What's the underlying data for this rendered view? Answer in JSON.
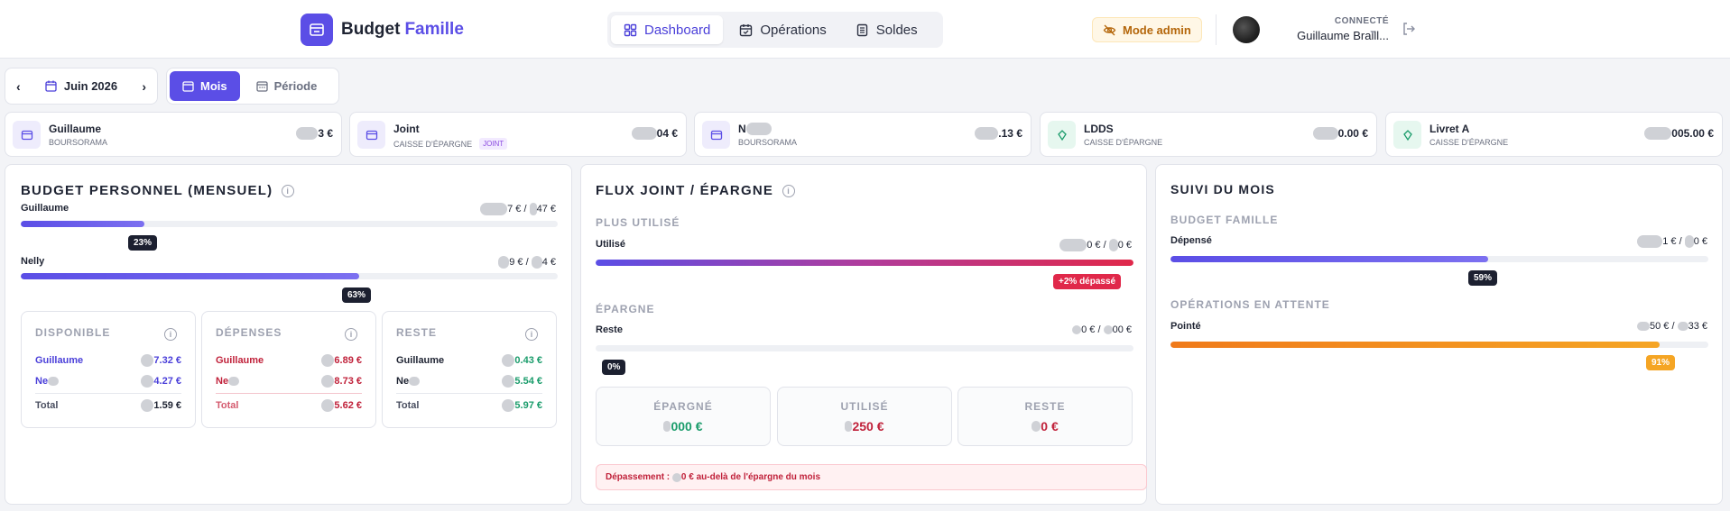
{
  "brand": {
    "name": "Budget",
    "accent": "Famille"
  },
  "nav": {
    "tabs": [
      {
        "label": "Dashboard"
      },
      {
        "label": "Opérations"
      },
      {
        "label": "Soldes"
      }
    ]
  },
  "admin": {
    "label": "Mode admin"
  },
  "user": {
    "status": "CONNECTÉ",
    "name": "Guillaume Braill..."
  },
  "period": {
    "label": "Juin 2026"
  },
  "modes": {
    "month": "Mois",
    "range": "Période"
  },
  "accounts": [
    {
      "name": "Guillaume",
      "bank": "BOURSORAMA",
      "tag": "",
      "amount": "3 €"
    },
    {
      "name": "Joint",
      "bank": "CAISSE D'ÉPARGNE",
      "tag": "JOINT",
      "amount": "04 €"
    },
    {
      "name": "N",
      "bank": "BOURSORAMA",
      "tag": "",
      "amount": ".13 €"
    },
    {
      "name": "LDDS",
      "bank": "CAISSE D'ÉPARGNE",
      "tag": "",
      "amount": "0.00 €"
    },
    {
      "name": "Livret A",
      "bank": "CAISSE D'ÉPARGNE",
      "tag": "",
      "amount": "005.00 €"
    }
  ],
  "personal": {
    "title": "BUDGET PERSONNEL (MENSUEL)",
    "rows": [
      {
        "name": "Guillaume",
        "amount_a": "7 €",
        "sep": "/",
        "amount_b": "47 €",
        "percent": 23,
        "badge": "23%"
      },
      {
        "name": "Nelly",
        "amount_a": "9 €",
        "sep": "/",
        "amount_b": "4 €",
        "percent": 63,
        "badge": "63%"
      }
    ],
    "cards": [
      {
        "title": "DISPONIBLE",
        "rows": [
          {
            "label": "Guillaume",
            "value": "7.32 €"
          },
          {
            "label": "Ne",
            "value": "4.27 €"
          }
        ],
        "total_label": "Total",
        "total": "1.59 €"
      },
      {
        "title": "DÉPENSES",
        "rows": [
          {
            "label": "Guillaume",
            "value": "6.89 €"
          },
          {
            "label": "Ne",
            "value": "8.73 €"
          }
        ],
        "total_label": "Total",
        "total": "5.62 €"
      },
      {
        "title": "RESTE",
        "rows": [
          {
            "label": "Guillaume",
            "value": "0.43 €"
          },
          {
            "label": "Ne",
            "value": "5.54 €"
          }
        ],
        "total_label": "Total",
        "total": "5.97 €"
      }
    ]
  },
  "flux": {
    "title": "FLUX JOINT / ÉPARGNE",
    "used_section": "PLUS UTILISÉ",
    "used_label": "Utilisé",
    "used_amount_a": "0 €",
    "used_sep": "/",
    "used_amount_b": "0 €",
    "used_percent": 102,
    "over_badge": "+2% dépassé",
    "savings_section": "ÉPARGNE",
    "rest_label": "Reste",
    "rest_amount_a": "0 €",
    "rest_sep": "/",
    "rest_amount_b": "00 €",
    "rest_percent": 0,
    "rest_badge": "0%",
    "boxes": [
      {
        "title": "ÉPARGNÉ",
        "value": "000 €"
      },
      {
        "title": "UTILISÉ",
        "value": "250 €"
      },
      {
        "title": "RESTE",
        "value": "0 €"
      }
    ],
    "alert_prefix": "Dépassement :",
    "alert_suffix": "0 € au-delà de l'épargne du mois"
  },
  "suivi": {
    "title": "SUIVI DU MOIS",
    "budget_section": "BUDGET FAMILLE",
    "spent_label": "Dépensé",
    "spent_amount_a": "1 €",
    "spent_sep": "/",
    "spent_amount_b": "0 €",
    "spent_percent": 59,
    "spent_badge": "59%",
    "pending_section": "OPÉRATIONS EN ATTENTE",
    "pointed_label": "Pointé",
    "pointed_amount_a": "50 €",
    "pointed_sep": "/",
    "pointed_amount_b": "33 €",
    "pointed_percent": 91,
    "pointed_badge": "91%"
  },
  "colors": {
    "accent": "#5b4ee6",
    "green": "#1a9c6b",
    "red": "#c0213a",
    "orange": "#f07a1a",
    "badge_amber": "#f5a524"
  }
}
